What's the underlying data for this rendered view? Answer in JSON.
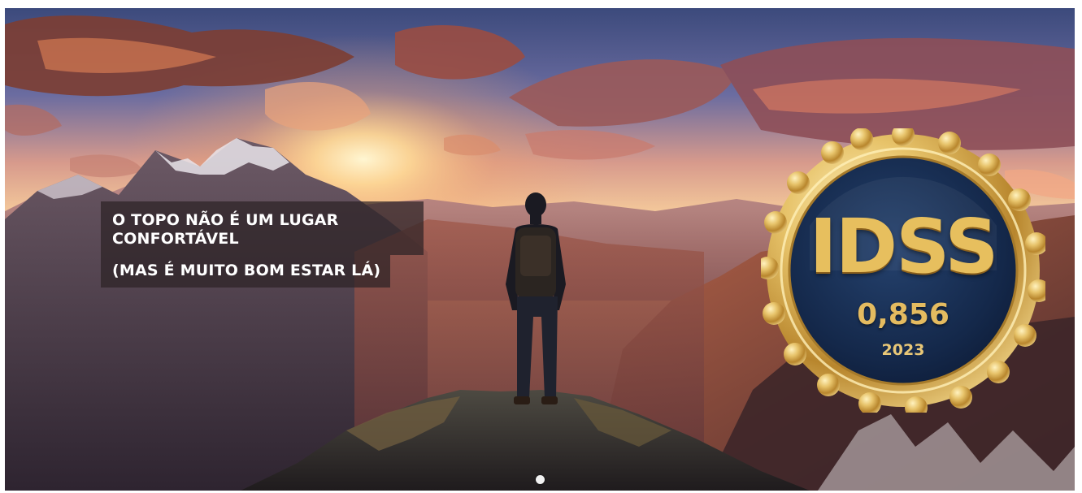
{
  "hero": {
    "caption": {
      "line1": "O TOPO NÃO É UM LUGAR CONFORTÁVEL",
      "line2": "(MAS É MUITO BOM ESTAR LÁ)"
    },
    "badge": {
      "title": "IDSS",
      "score": "0,856",
      "year": "2023"
    },
    "carousel": {
      "slide_count": 1,
      "active_index": 0
    },
    "colors": {
      "badge_navy": "#13294a",
      "badge_gold": "#d6a93f",
      "sunset_orange": "#e8763a"
    }
  }
}
